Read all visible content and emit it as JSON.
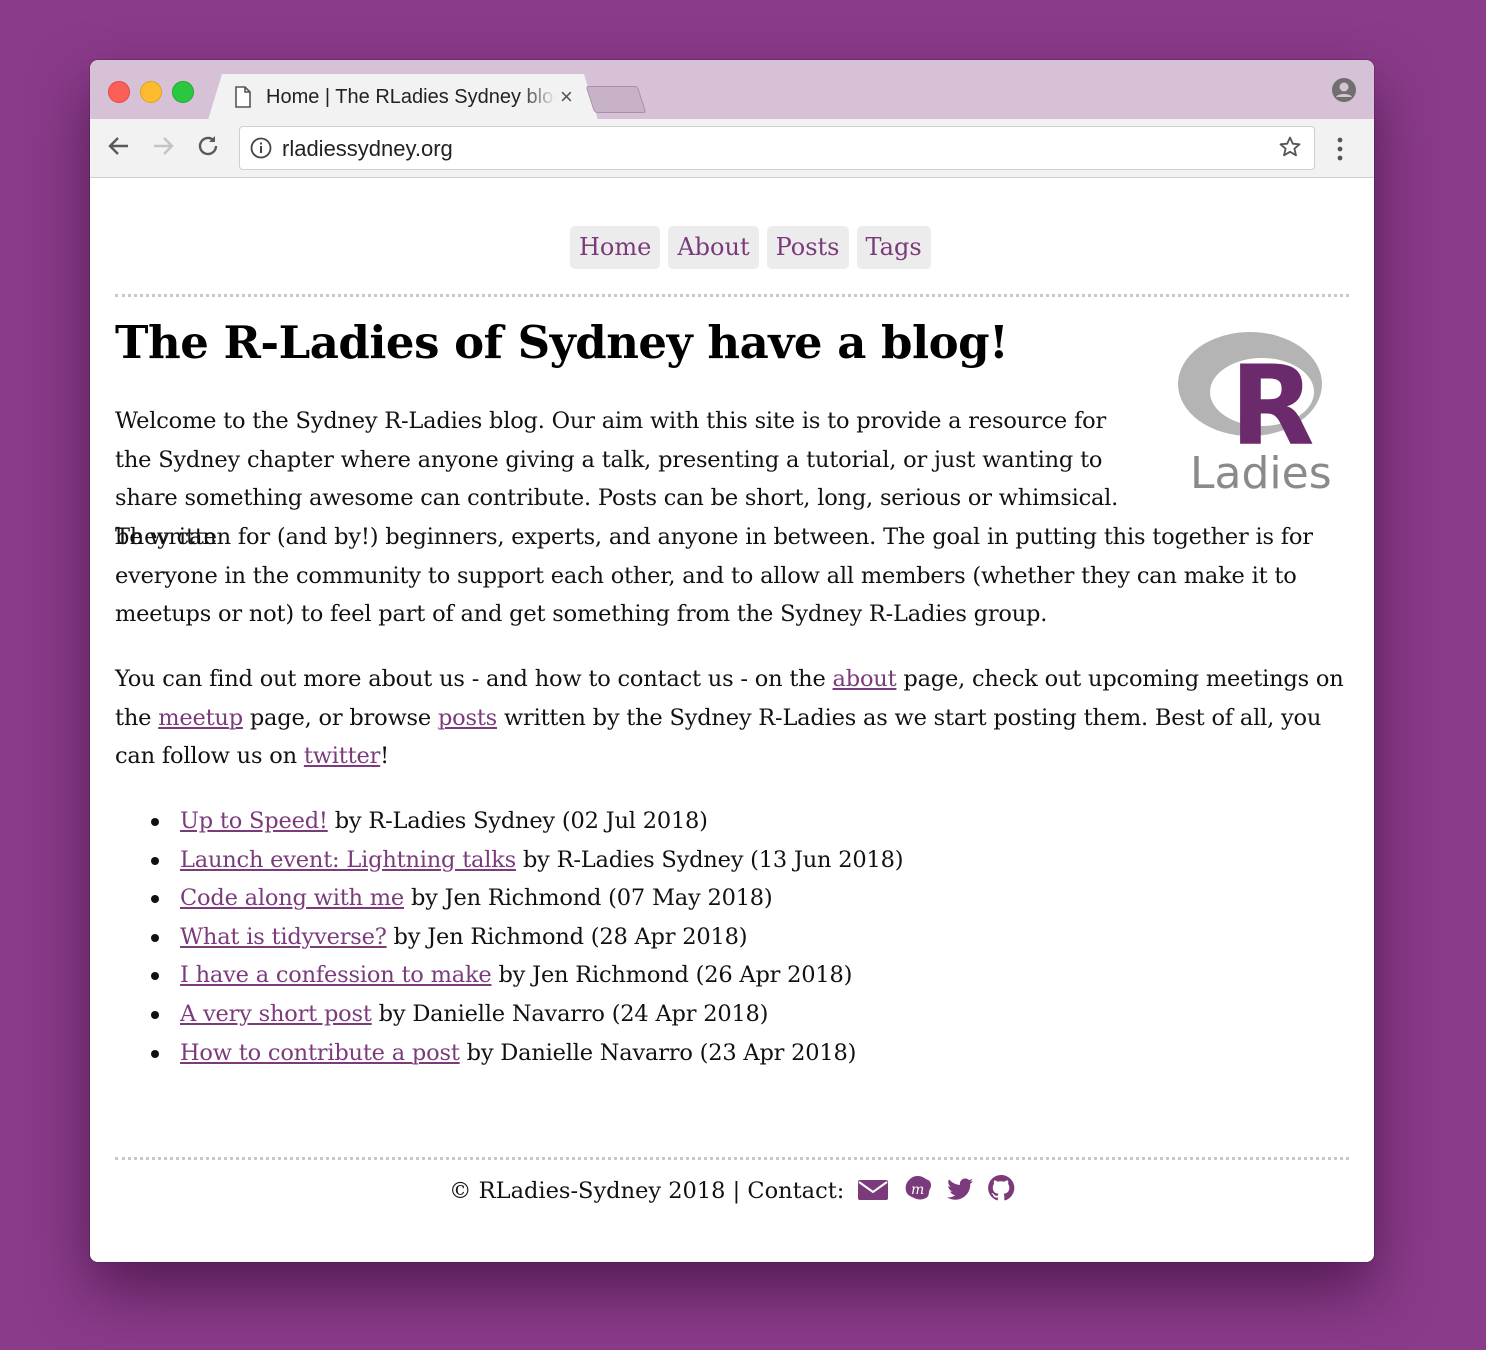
{
  "browser": {
    "tab_title": "Home | The RLadies Sydney blog",
    "tab_close": "×",
    "url": "rladiessydney.org"
  },
  "nav": {
    "items": [
      {
        "label": "Home"
      },
      {
        "label": "About"
      },
      {
        "label": "Posts"
      },
      {
        "label": "Tags"
      }
    ]
  },
  "main": {
    "title": "The R-Ladies of Sydney have a blog!",
    "logo_text": "Ladies",
    "logo_letter": "R",
    "intro_line1": "Welcome to the Sydney R-Ladies blog. Our aim with this site is to provide a resource for the Sydney chapter where anyone giving a talk, presenting a tutorial, or just wanting to share something awesome can contribute. Posts can be short, long, serious or whimsical. They can",
    "intro_line2": "be written for (and by!) beginners, experts, and anyone in between. The goal in putting this together is for everyone in the community to support each other, and to allow all members (whether they can make it to meetups or not) to feel part of and get something from the Sydney R-Ladies group.",
    "more": {
      "t1": "You can find out more about us - and how to contact us - on the ",
      "about_link": "about",
      "t2": " page, check out upcoming meetings on the ",
      "meetup_link": "meetup",
      "t3": " page, or browse ",
      "posts_link": "posts",
      "t4": " written by the Sydney R-Ladies as we start posting them. Best of all, you can follow us on ",
      "twitter_link": "twitter",
      "t5": "!"
    },
    "posts": [
      {
        "title": "Up to Speed!",
        "meta": " by R-Ladies Sydney (02 Jul 2018)"
      },
      {
        "title": "Launch event: Lightning talks",
        "meta": " by R-Ladies Sydney (13 Jun 2018)"
      },
      {
        "title": "Code along with me",
        "meta": " by Jen Richmond (07 May 2018)"
      },
      {
        "title": "What is tidyverse?",
        "meta": " by Jen Richmond (28 Apr 2018)"
      },
      {
        "title": "I have a confession to make",
        "meta": " by Jen Richmond (26 Apr 2018)"
      },
      {
        "title": "A very short post",
        "meta": " by Danielle Navarro (24 Apr 2018)"
      },
      {
        "title": "How to contribute a post",
        "meta": " by Danielle Navarro (23 Apr 2018)"
      }
    ]
  },
  "footer": {
    "text": "© RLadies-Sydney 2018 | Contact:",
    "icons": [
      "envelope-icon",
      "meetup-icon",
      "twitter-icon",
      "github-icon"
    ]
  },
  "colors": {
    "background": "#8a3b8a",
    "accent": "#7b3b7b",
    "logo_purple": "#6b2a6b"
  }
}
